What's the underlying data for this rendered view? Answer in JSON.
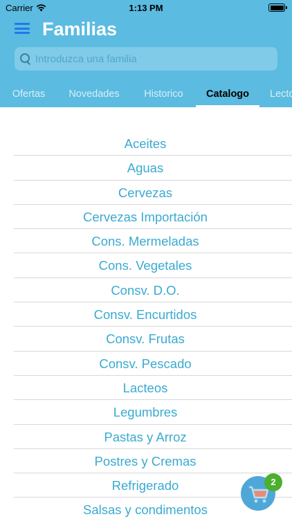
{
  "status_bar": {
    "carrier": "Carrier",
    "time": "1:13 PM"
  },
  "header": {
    "title": "Familias"
  },
  "search": {
    "placeholder": "Introduzca una familia"
  },
  "tabs": [
    {
      "label": "Ofertas",
      "active": false
    },
    {
      "label": "Novedades",
      "active": false
    },
    {
      "label": "Historico",
      "active": false
    },
    {
      "label": "Catalogo",
      "active": true
    },
    {
      "label": "Lecto",
      "active": false
    }
  ],
  "families": [
    "Aceites",
    "Aguas",
    "Cervezas",
    "Cervezas Importación",
    "Cons. Mermeladas",
    "Cons. Vegetales",
    "Consv. D.O.",
    "Consv. Encurtidos",
    "Consv. Frutas",
    "Consv. Pescado",
    "Lacteos",
    "Legumbres",
    "Pastas y Arroz",
    "Postres y Cremas",
    "Refrigerado",
    "Salsas y condimentos"
  ],
  "cart": {
    "badge_count": "2"
  },
  "colors": {
    "header": "#5bbbe0",
    "accent": "#3aaad0",
    "menu": "#1e7ae8",
    "badge": "#4caf2e",
    "fab": "#4fa7d8"
  },
  "icons": {
    "menu": "hamburger-icon",
    "search": "search-icon",
    "wifi": "wifi-icon",
    "battery": "battery-icon",
    "cart": "shopping-cart-icon"
  }
}
